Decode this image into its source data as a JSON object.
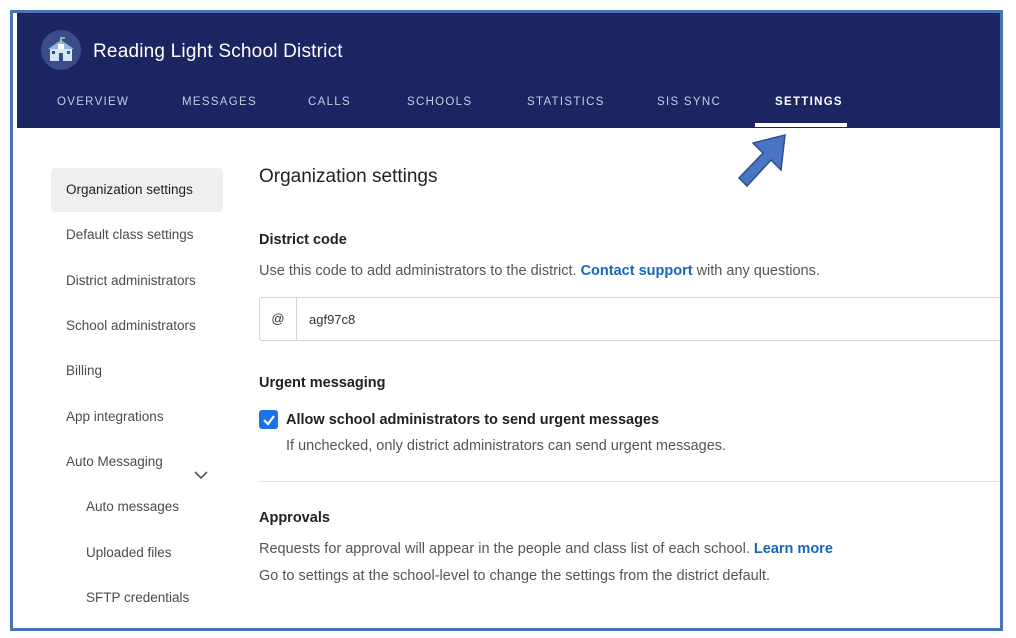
{
  "app": {
    "title": "Reading Light School District"
  },
  "nav": {
    "items": [
      {
        "label": "OVERVIEW"
      },
      {
        "label": "MESSAGES"
      },
      {
        "label": "CALLS"
      },
      {
        "label": "SCHOOLS"
      },
      {
        "label": "STATISTICS"
      },
      {
        "label": "SIS SYNC"
      },
      {
        "label": "SETTINGS"
      }
    ],
    "active": "SETTINGS"
  },
  "sidebar": {
    "items": [
      {
        "label": "Organization settings"
      },
      {
        "label": "Default class settings"
      },
      {
        "label": "District administrators"
      },
      {
        "label": "School administrators"
      },
      {
        "label": "Billing"
      },
      {
        "label": "App integrations"
      },
      {
        "label": "Auto Messaging"
      },
      {
        "label": "Auto messages"
      },
      {
        "label": "Uploaded files"
      },
      {
        "label": "SFTP credentials"
      }
    ]
  },
  "main": {
    "title": "Organization settings",
    "district_code": {
      "heading": "District code",
      "desc_before": "Use this code to add administrators to the district.",
      "link": "Contact support",
      "desc_after": "with any questions.",
      "prefix": "@",
      "value": "agf97c8"
    },
    "urgent": {
      "heading": "Urgent messaging",
      "checkbox_label": "Allow school administrators to send urgent messages",
      "checked": true,
      "help": "If unchecked, only district administrators can send urgent messages."
    },
    "approvals": {
      "heading": "Approvals",
      "line1": "Requests for approval will appear in the people and class list of each school.",
      "link": "Learn more",
      "line2": "Go to settings at the school-level to change the settings from the district default."
    }
  },
  "colors": {
    "header": "#1c2461",
    "accent": "#1a73e8",
    "link": "#1565c0",
    "frame": "#4a74b8"
  },
  "icons": {
    "logo": "school-building-icon",
    "checkbox": "check-icon",
    "expand": "chevron-down-icon",
    "annotation": "arrow-icon"
  }
}
